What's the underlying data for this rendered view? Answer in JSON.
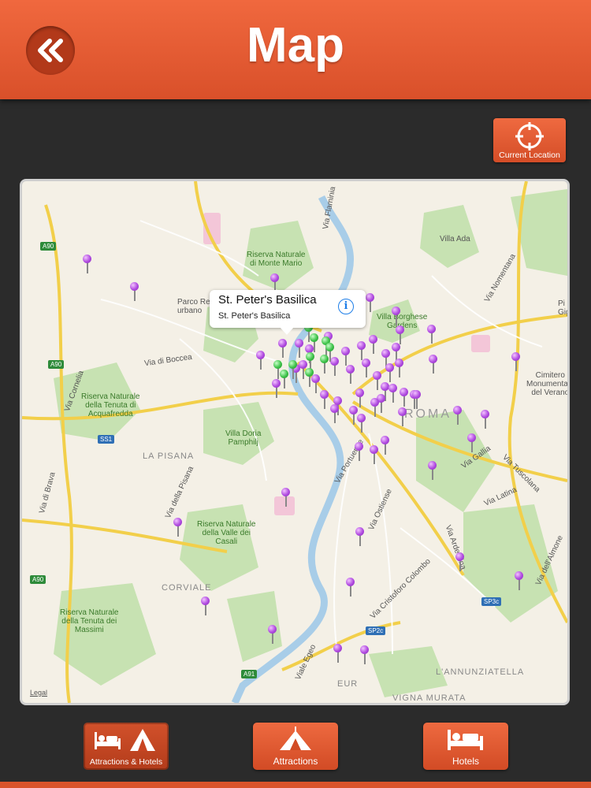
{
  "header": {
    "title": "Map"
  },
  "current_location": {
    "label": "Current Location"
  },
  "map": {
    "callout": {
      "title": "St. Peter's Basilica",
      "subtitle": "St. Peter's Basilica"
    },
    "labels": {
      "via_flaminia": "Via Flaminia",
      "villa_ada": "Villa Ada",
      "monte_mario": "Riserva Naturale\ndi Monte Mario",
      "parco_urbano": "Parco Re\nurbano",
      "villa_borghese": "Villa Borghese\nGardens",
      "via_nomentana": "Via Nomentana",
      "via_boccea": "Via di Boccea",
      "via_cornelia": "Via Cornelia",
      "acquafredda": "Riserva Naturale\ndella Tenuta di\nAcquafredda",
      "cimitero": "Cimitero\nMonumentale\ndel Verano",
      "roma": "ROMA",
      "villa_doria": "Villa Doria\nPamphilj",
      "la_pisana": "LA PISANA",
      "via_gallia": "Via Gallia",
      "via_tuscolana": "Via Tuscolana",
      "via_portuense": "Via Portuense",
      "via_brava": "Via di Brava",
      "via_pisana": "Via della Pisana",
      "via_latina": "Via Latina",
      "via_ostiense": "Via Ostiense",
      "valle_casali": "Riserva Naturale\ndella Valle dei\nCasali",
      "via_ardeatina": "Via Ardeatina",
      "via_appia": "Via dell'Almone",
      "corviale": "CORVIALE",
      "via_colombo": "Via Cristoforo Colombo",
      "tenuta_massimi": "Riserva Naturale\ndella Tenuta dei\nMassimi",
      "viale_egeo": "Viale Egeo",
      "eur": "EUR",
      "annunziatella": "L'ANNUNZIATELLA",
      "vigna_murata": "VIGNA MURATA",
      "pigli": "Pi\nGigli"
    },
    "shields": {
      "a90_top": "A90",
      "a90_mid": "A90",
      "a90_low": "A90",
      "ss1": "SS1",
      "sp2c": "SP2c",
      "sp3c": "SP3c",
      "a91": "A91"
    },
    "legal": "Legal"
  },
  "tabs": [
    {
      "label": "Attractions & Hotels"
    },
    {
      "label": "Attractions"
    },
    {
      "label": "Hotels"
    }
  ],
  "colors": {
    "accent": "#e05a30",
    "pin_purple": "#b04be0",
    "pin_green": "#3ec24a"
  }
}
